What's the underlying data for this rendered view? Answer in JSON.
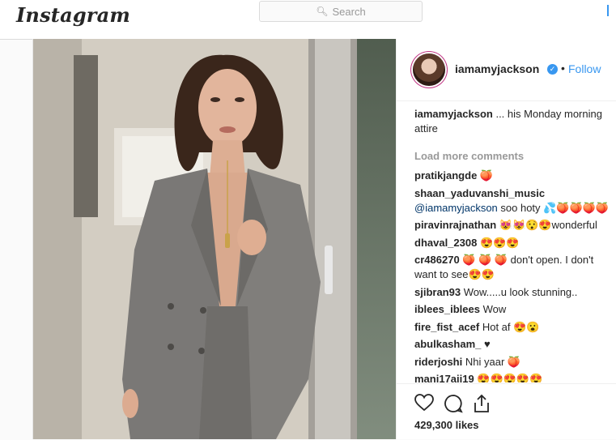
{
  "topbar": {
    "logo": "Instagram",
    "search_placeholder": "Search",
    "search_icon": "search-icon"
  },
  "post": {
    "author": {
      "username": "iamamyjackson",
      "verified_icon": "verified-badge-icon",
      "separator": "•",
      "follow_label": "Follow"
    },
    "caption": {
      "username": "iamamyjackson",
      "text": " ... his Monday morning attire"
    },
    "load_more_label": "Load more comments",
    "comments": [
      {
        "user": "pratikjangde",
        "text": " 🍑"
      },
      {
        "user": "shaan_yaduvanshi_music",
        "mention": " @iamamyjackson",
        "text": " soo hoty 💦🍑🍑🍑🍑"
      },
      {
        "user": "piravinrajnathan",
        "text": " 😻😻😯😍wonderful"
      },
      {
        "user": "dhaval_2308",
        "text": " 😍😍😍"
      },
      {
        "user": "cr486270",
        "text": " 🍑 🍑 🍑 don't open. I don't want to see😍😍"
      },
      {
        "user": "sjibran93",
        "text": " Wow.....u look stunning.."
      },
      {
        "user": "iblees_iblees",
        "text": " Wow"
      },
      {
        "user": "fire_fist_acef",
        "text": " Hot af 😍😮"
      },
      {
        "user": "abulkasham_",
        "text": " ♥"
      },
      {
        "user": "riderjoshi",
        "text": " Nhi yaar 🍑"
      },
      {
        "user": "mani17aji19",
        "text": " 😍😍😍😍😍"
      }
    ],
    "actions": {
      "like_icon": "heart-icon",
      "comment_icon": "comment-icon",
      "share_icon": "share-icon"
    },
    "likes_label": "429,300 likes"
  }
}
